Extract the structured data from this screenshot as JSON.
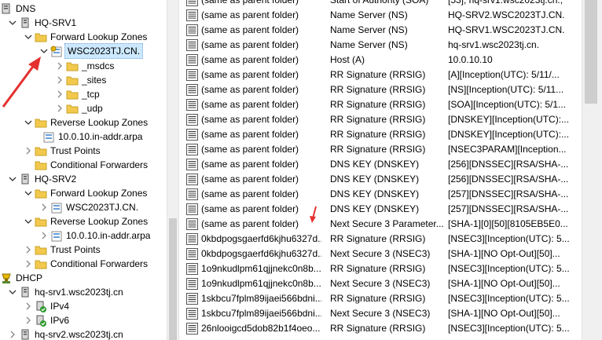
{
  "tree": {
    "dns_root": "DNS",
    "hq_srv1": "HQ-SRV1",
    "forward_zones_1": "Forward Lookup Zones",
    "zone_selected": "WSC2023TJ.CN.",
    "msdcs": "_msdcs",
    "sites": "_sites",
    "tcp": "_tcp",
    "udp": "_udp",
    "reverse_zones_1": "Reverse Lookup Zones",
    "reverse_zone_1": "10.0.10.in-addr.arpa",
    "trust_points_1": "Trust Points",
    "cond_fwd_1": "Conditional Forwarders",
    "hq_srv2": "HQ-SRV2",
    "forward_zones_2": "Forward Lookup Zones",
    "zone_2": "WSC2023TJ.CN.",
    "reverse_zones_2": "Reverse Lookup Zones",
    "reverse_zone_2": "10.0.10.in-addr.arpa",
    "trust_points_2": "Trust Points",
    "cond_fwd_2": "Conditional Forwarders",
    "dhcp_root": "DHCP",
    "dhcp_srv1": "hq-srv1.wsc2023tj.cn",
    "ipv4": "IPv4",
    "ipv6": "IPv6",
    "dhcp_srv2": "hq-srv2.wsc2023tj.cn"
  },
  "records": [
    {
      "name": "(same as parent folder)",
      "type": "Start of Authority (SOA)",
      "data": "[53], hq-srv1.wsc2023tj.cn.,"
    },
    {
      "name": "(same as parent folder)",
      "type": "Name Server (NS)",
      "data": "HQ-SRV2.WSC2023TJ.CN."
    },
    {
      "name": "(same as parent folder)",
      "type": "Name Server (NS)",
      "data": "HQ-SRV1.WSC2023TJ.CN."
    },
    {
      "name": "(same as parent folder)",
      "type": "Name Server (NS)",
      "data": "hq-srv1.wsc2023tj.cn."
    },
    {
      "name": "(same as parent folder)",
      "type": "Host (A)",
      "data": "10.0.10.10"
    },
    {
      "name": "(same as parent folder)",
      "type": "RR Signature (RRSIG)",
      "data": "[A][Inception(UTC): 5/11/..."
    },
    {
      "name": "(same as parent folder)",
      "type": "RR Signature (RRSIG)",
      "data": "[NS][Inception(UTC): 5/11..."
    },
    {
      "name": "(same as parent folder)",
      "type": "RR Signature (RRSIG)",
      "data": "[SOA][Inception(UTC): 5/1..."
    },
    {
      "name": "(same as parent folder)",
      "type": "RR Signature (RRSIG)",
      "data": "[DNSKEY][Inception(UTC):..."
    },
    {
      "name": "(same as parent folder)",
      "type": "RR Signature (RRSIG)",
      "data": "[DNSKEY][Inception(UTC):..."
    },
    {
      "name": "(same as parent folder)",
      "type": "RR Signature (RRSIG)",
      "data": "[NSEC3PARAM][Inception..."
    },
    {
      "name": "(same as parent folder)",
      "type": "DNS KEY (DNSKEY)",
      "data": "[256][DNSSEC][RSA/SHA-..."
    },
    {
      "name": "(same as parent folder)",
      "type": "DNS KEY (DNSKEY)",
      "data": "[256][DNSSEC][RSA/SHA-..."
    },
    {
      "name": "(same as parent folder)",
      "type": "DNS KEY (DNSKEY)",
      "data": "[257][DNSSEC][RSA/SHA-..."
    },
    {
      "name": "(same as parent folder)",
      "type": "DNS KEY (DNSKEY)",
      "data": "[257][DNSSEC][RSA/SHA-..."
    },
    {
      "name": "(same as parent folder)",
      "type": "Next Secure 3 Parameter...",
      "data": "[SHA-1][0][50][8105EB5E0..."
    },
    {
      "name": "0kbdpogsgaerfd6kjhu6327d...",
      "type": "RR Signature (RRSIG)",
      "data": "[NSEC3][Inception(UTC): 5..."
    },
    {
      "name": "0kbdpogsgaerfd6kjhu6327d...",
      "type": "Next Secure 3 (NSEC3)",
      "data": "[SHA-1][NO Opt-Out][50]..."
    },
    {
      "name": "1o9nkudlpm61qjjnekc0n8b...",
      "type": "RR Signature (RRSIG)",
      "data": "[NSEC3][Inception(UTC): 5..."
    },
    {
      "name": "1o9nkudlpm61qjjnekc0n8b...",
      "type": "Next Secure 3 (NSEC3)",
      "data": "[SHA-1][NO Opt-Out][50]..."
    },
    {
      "name": "1skbcu7fplm89ijaei566bdni...",
      "type": "RR Signature (RRSIG)",
      "data": "[NSEC3][Inception(UTC): 5..."
    },
    {
      "name": "1skbcu7fplm89ijaei566bdni...",
      "type": "Next Secure 3 (NSEC3)",
      "data": "[SHA-1][NO Opt-Out][50]..."
    },
    {
      "name": "26nlooigcd5dob82b1f4oeo...",
      "type": "RR Signature (RRSIG)",
      "data": "[NSEC3][Inception(UTC): 5..."
    }
  ]
}
